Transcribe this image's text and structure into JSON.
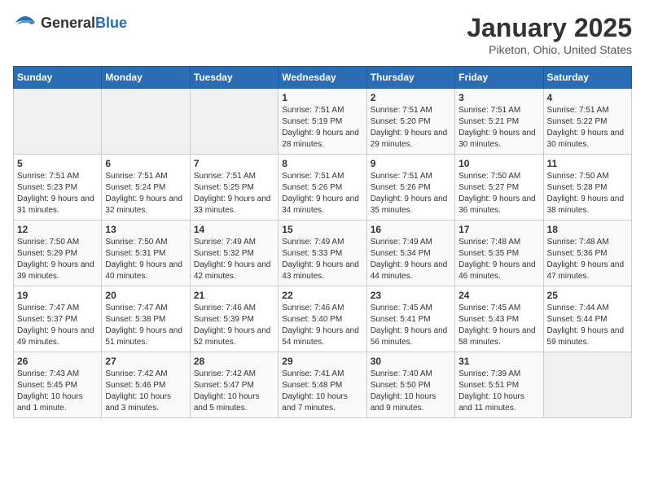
{
  "header": {
    "logo_general": "General",
    "logo_blue": "Blue",
    "title": "January 2025",
    "subtitle": "Piketon, Ohio, United States"
  },
  "days_of_week": [
    "Sunday",
    "Monday",
    "Tuesday",
    "Wednesday",
    "Thursday",
    "Friday",
    "Saturday"
  ],
  "weeks": [
    [
      {
        "day": "",
        "empty": true
      },
      {
        "day": "",
        "empty": true
      },
      {
        "day": "",
        "empty": true
      },
      {
        "day": "1",
        "sunrise": "7:51 AM",
        "sunset": "5:19 PM",
        "daylight": "9 hours and 28 minutes."
      },
      {
        "day": "2",
        "sunrise": "7:51 AM",
        "sunset": "5:20 PM",
        "daylight": "9 hours and 29 minutes."
      },
      {
        "day": "3",
        "sunrise": "7:51 AM",
        "sunset": "5:21 PM",
        "daylight": "9 hours and 30 minutes."
      },
      {
        "day": "4",
        "sunrise": "7:51 AM",
        "sunset": "5:22 PM",
        "daylight": "9 hours and 30 minutes."
      }
    ],
    [
      {
        "day": "5",
        "sunrise": "7:51 AM",
        "sunset": "5:23 PM",
        "daylight": "9 hours and 31 minutes."
      },
      {
        "day": "6",
        "sunrise": "7:51 AM",
        "sunset": "5:24 PM",
        "daylight": "9 hours and 32 minutes."
      },
      {
        "day": "7",
        "sunrise": "7:51 AM",
        "sunset": "5:25 PM",
        "daylight": "9 hours and 33 minutes."
      },
      {
        "day": "8",
        "sunrise": "7:51 AM",
        "sunset": "5:26 PM",
        "daylight": "9 hours and 34 minutes."
      },
      {
        "day": "9",
        "sunrise": "7:51 AM",
        "sunset": "5:26 PM",
        "daylight": "9 hours and 35 minutes."
      },
      {
        "day": "10",
        "sunrise": "7:50 AM",
        "sunset": "5:27 PM",
        "daylight": "9 hours and 36 minutes."
      },
      {
        "day": "11",
        "sunrise": "7:50 AM",
        "sunset": "5:28 PM",
        "daylight": "9 hours and 38 minutes."
      }
    ],
    [
      {
        "day": "12",
        "sunrise": "7:50 AM",
        "sunset": "5:29 PM",
        "daylight": "9 hours and 39 minutes."
      },
      {
        "day": "13",
        "sunrise": "7:50 AM",
        "sunset": "5:31 PM",
        "daylight": "9 hours and 40 minutes."
      },
      {
        "day": "14",
        "sunrise": "7:49 AM",
        "sunset": "5:32 PM",
        "daylight": "9 hours and 42 minutes."
      },
      {
        "day": "15",
        "sunrise": "7:49 AM",
        "sunset": "5:33 PM",
        "daylight": "9 hours and 43 minutes."
      },
      {
        "day": "16",
        "sunrise": "7:49 AM",
        "sunset": "5:34 PM",
        "daylight": "9 hours and 44 minutes."
      },
      {
        "day": "17",
        "sunrise": "7:48 AM",
        "sunset": "5:35 PM",
        "daylight": "9 hours and 46 minutes."
      },
      {
        "day": "18",
        "sunrise": "7:48 AM",
        "sunset": "5:36 PM",
        "daylight": "9 hours and 47 minutes."
      }
    ],
    [
      {
        "day": "19",
        "sunrise": "7:47 AM",
        "sunset": "5:37 PM",
        "daylight": "9 hours and 49 minutes."
      },
      {
        "day": "20",
        "sunrise": "7:47 AM",
        "sunset": "5:38 PM",
        "daylight": "9 hours and 51 minutes."
      },
      {
        "day": "21",
        "sunrise": "7:46 AM",
        "sunset": "5:39 PM",
        "daylight": "9 hours and 52 minutes."
      },
      {
        "day": "22",
        "sunrise": "7:46 AM",
        "sunset": "5:40 PM",
        "daylight": "9 hours and 54 minutes."
      },
      {
        "day": "23",
        "sunrise": "7:45 AM",
        "sunset": "5:41 PM",
        "daylight": "9 hours and 56 minutes."
      },
      {
        "day": "24",
        "sunrise": "7:45 AM",
        "sunset": "5:43 PM",
        "daylight": "9 hours and 58 minutes."
      },
      {
        "day": "25",
        "sunrise": "7:44 AM",
        "sunset": "5:44 PM",
        "daylight": "9 hours and 59 minutes."
      }
    ],
    [
      {
        "day": "26",
        "sunrise": "7:43 AM",
        "sunset": "5:45 PM",
        "daylight": "10 hours and 1 minute."
      },
      {
        "day": "27",
        "sunrise": "7:42 AM",
        "sunset": "5:46 PM",
        "daylight": "10 hours and 3 minutes."
      },
      {
        "day": "28",
        "sunrise": "7:42 AM",
        "sunset": "5:47 PM",
        "daylight": "10 hours and 5 minutes."
      },
      {
        "day": "29",
        "sunrise": "7:41 AM",
        "sunset": "5:48 PM",
        "daylight": "10 hours and 7 minutes."
      },
      {
        "day": "30",
        "sunrise": "7:40 AM",
        "sunset": "5:50 PM",
        "daylight": "10 hours and 9 minutes."
      },
      {
        "day": "31",
        "sunrise": "7:39 AM",
        "sunset": "5:51 PM",
        "daylight": "10 hours and 11 minutes."
      },
      {
        "day": "",
        "empty": true
      }
    ]
  ]
}
